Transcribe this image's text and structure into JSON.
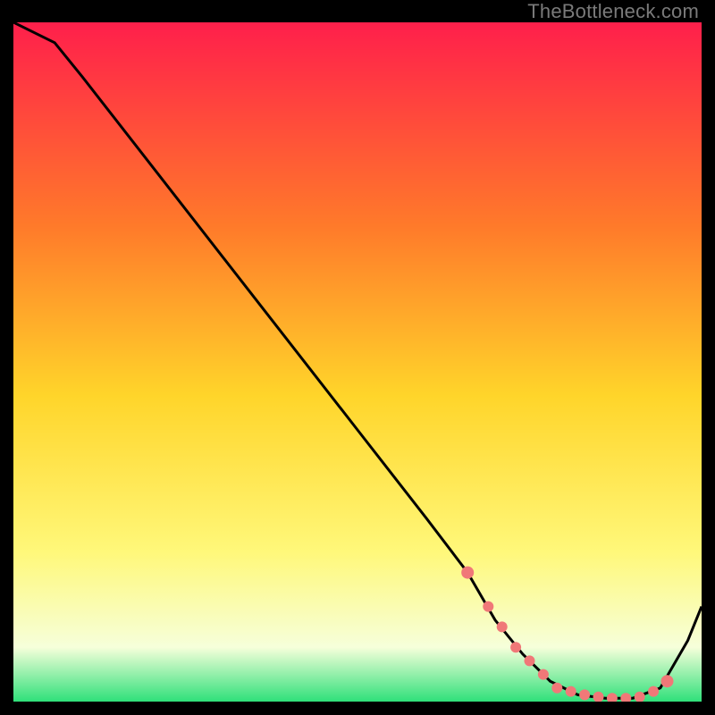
{
  "watermark": "TheBottleneck.com",
  "colors": {
    "gradient_top": "#ff1f4b",
    "gradient_mid1": "#ff7a2a",
    "gradient_mid2": "#ffd52a",
    "gradient_mid3": "#fff87a",
    "gradient_bottom": "#2fe07a",
    "curve": "#000000",
    "marker": "#f07878",
    "frame": "#000000"
  },
  "chart_data": {
    "type": "line",
    "title": "",
    "xlabel": "",
    "ylabel": "",
    "xlim": [
      0,
      100
    ],
    "ylim": [
      0,
      100
    ],
    "series": [
      {
        "name": "bottleneck-curve",
        "x": [
          0,
          6,
          10,
          20,
          30,
          40,
          50,
          60,
          66,
          70,
          74,
          78,
          82,
          86,
          90,
          94,
          98,
          100
        ],
        "y": [
          100,
          97,
          92,
          79,
          66,
          53,
          40,
          27,
          19,
          12,
          7,
          3,
          1,
          0.5,
          0.5,
          2,
          9,
          14
        ]
      }
    ],
    "markers": {
      "name": "highlighted-points",
      "x": [
        66,
        69,
        71,
        73,
        75,
        77,
        79,
        81,
        83,
        85,
        87,
        89,
        91,
        93,
        95
      ],
      "y": [
        19,
        14,
        11,
        8,
        6,
        4,
        2,
        1.5,
        1,
        0.7,
        0.5,
        0.5,
        0.7,
        1.5,
        3
      ]
    }
  }
}
